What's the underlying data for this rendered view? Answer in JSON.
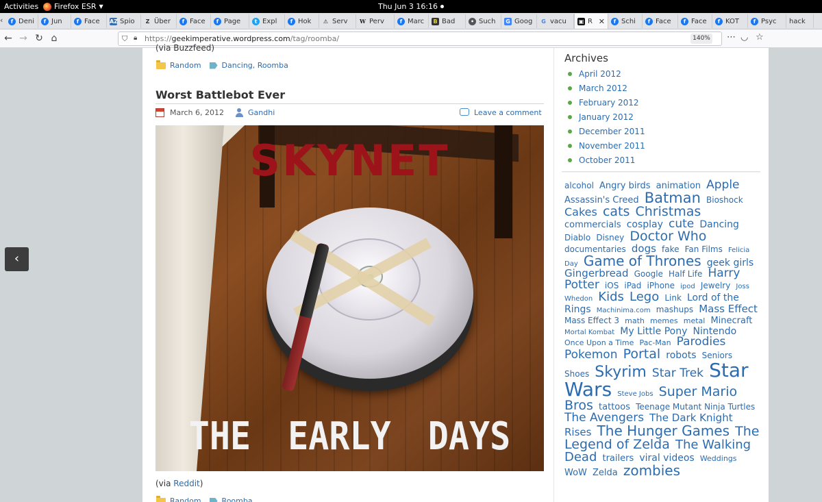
{
  "system": {
    "activities": "Activities",
    "app_name": "Firefox ESR",
    "clock": "Thu Jun 3  16:16"
  },
  "tabs": [
    {
      "label": "Deni",
      "icon": "generic-icon"
    },
    {
      "label": "Jun",
      "icon": "facebook-icon"
    },
    {
      "label": "Face",
      "icon": "facebook-icon"
    },
    {
      "label": "Spio",
      "icon": "az-icon"
    },
    {
      "label": "Über",
      "icon": "z-icon"
    },
    {
      "label": "Face",
      "icon": "facebook-icon"
    },
    {
      "label": "Page",
      "icon": "facebook-icon"
    },
    {
      "label": "Expl",
      "icon": "twitter-icon"
    },
    {
      "label": "Hok",
      "icon": "facebook-icon"
    },
    {
      "label": "Serv",
      "icon": "warning-icon"
    },
    {
      "label": "Perv",
      "icon": "wikipedia-icon"
    },
    {
      "label": "Marc",
      "icon": "facebook-icon"
    },
    {
      "label": "Bad",
      "icon": "bad-icon"
    },
    {
      "label": "Such",
      "icon": "circle-icon"
    },
    {
      "label": "Goog",
      "icon": "google-translate-icon"
    },
    {
      "label": "vacu",
      "icon": "google-icon"
    },
    {
      "label": "R",
      "icon": "wordpress-icon",
      "active": true
    },
    {
      "label": "Schi",
      "icon": "facebook-icon"
    },
    {
      "label": "Face",
      "icon": "facebook-icon"
    },
    {
      "label": "Face",
      "icon": "facebook-icon"
    },
    {
      "label": "KOT",
      "icon": "facebook-icon"
    },
    {
      "label": "Psyc",
      "icon": "facebook-icon"
    },
    {
      "label": "hack",
      "icon": "none"
    }
  ],
  "navbar": {
    "url_prefix": "https://",
    "url_domain": "geekimperative.wordpress.com",
    "url_path": "/tag/roomba/",
    "zoom": "140%"
  },
  "previous_post": {
    "via": "(via Buzzfeed)",
    "category": "Random",
    "tags": "Dancing, Roomba"
  },
  "post": {
    "title": "Worst Battlebot Ever",
    "date": "March 6, 2012",
    "author": "Gandhi",
    "comment_link": "Leave a comment",
    "image_text_top": "SKYNET",
    "image_text_bottom": "THE EARLY DAYS",
    "via_prefix": "(via ",
    "via_link": "Reddit",
    "via_suffix": ")",
    "category": "Random",
    "tags": "Roomba"
  },
  "sidebar": {
    "archives_title": "Archives",
    "archives": [
      "April 2012",
      "March 2012",
      "February 2012",
      "January 2012",
      "December 2011",
      "November 2011",
      "October 2011"
    ],
    "tags": [
      {
        "t": "alcohol",
        "s": 12
      },
      {
        "t": "Angry birds",
        "s": 13
      },
      {
        "t": "animation",
        "s": 13
      },
      {
        "t": "Apple",
        "s": 17
      },
      {
        "t": "Assassin's Creed",
        "s": 13
      },
      {
        "t": "Batman",
        "s": 21
      },
      {
        "t": "Bioshock",
        "s": 12
      },
      {
        "t": "Cakes",
        "s": 16
      },
      {
        "t": "cats",
        "s": 19
      },
      {
        "t": "Christmas",
        "s": 19
      },
      {
        "t": "commercials",
        "s": 13
      },
      {
        "t": "cosplay",
        "s": 14
      },
      {
        "t": "cute",
        "s": 17
      },
      {
        "t": "Dancing",
        "s": 14
      },
      {
        "t": "Diablo",
        "s": 12
      },
      {
        "t": "Disney",
        "s": 12
      },
      {
        "t": "Doctor Who",
        "s": 19
      },
      {
        "t": "documentaries",
        "s": 12
      },
      {
        "t": "dogs",
        "s": 15
      },
      {
        "t": "fake",
        "s": 12
      },
      {
        "t": "Fan Films",
        "s": 12
      },
      {
        "t": "Felicia Day",
        "s": 10
      },
      {
        "t": "Game of Thrones",
        "s": 20
      },
      {
        "t": "geek girls",
        "s": 14
      },
      {
        "t": "Gingerbread",
        "s": 15
      },
      {
        "t": "Google",
        "s": 12
      },
      {
        "t": "Half Life",
        "s": 12
      },
      {
        "t": "Harry Potter",
        "s": 17
      },
      {
        "t": "iOS",
        "s": 12
      },
      {
        "t": "iPad",
        "s": 12
      },
      {
        "t": "iPhone",
        "s": 12
      },
      {
        "t": "ipod",
        "s": 10
      },
      {
        "t": "Jewelry",
        "s": 12
      },
      {
        "t": "Joss Whedon",
        "s": 10
      },
      {
        "t": "Kids",
        "s": 18
      },
      {
        "t": "Lego",
        "s": 18
      },
      {
        "t": "Link",
        "s": 12
      },
      {
        "t": "Lord of the Rings",
        "s": 14
      },
      {
        "t": "Machinima.com",
        "s": 10
      },
      {
        "t": "mashups",
        "s": 12
      },
      {
        "t": "Mass Effect",
        "s": 15
      },
      {
        "t": "Mass Effect 3",
        "s": 12
      },
      {
        "t": "math",
        "s": 11
      },
      {
        "t": "memes",
        "s": 11
      },
      {
        "t": "metal",
        "s": 11
      },
      {
        "t": "Minecraft",
        "s": 13
      },
      {
        "t": "Mortal Kombat",
        "s": 10
      },
      {
        "t": "My Little Pony",
        "s": 14
      },
      {
        "t": "Nintendo",
        "s": 14
      },
      {
        "t": "Once Upon a Time",
        "s": 11
      },
      {
        "t": "Pac-Man",
        "s": 11
      },
      {
        "t": "Parodies",
        "s": 17
      },
      {
        "t": "Pokemon",
        "s": 17
      },
      {
        "t": "Portal",
        "s": 19
      },
      {
        "t": "robots",
        "s": 14
      },
      {
        "t": "Seniors",
        "s": 12
      },
      {
        "t": "Shoes",
        "s": 12
      },
      {
        "t": "Skyrim",
        "s": 22
      },
      {
        "t": "Star Trek",
        "s": 17
      },
      {
        "t": "Star Wars",
        "s": 28
      },
      {
        "t": "Steve Jobs",
        "s": 10
      },
      {
        "t": "Super Mario Bros",
        "s": 19
      },
      {
        "t": "tattoos",
        "s": 13
      },
      {
        "t": "Teenage Mutant Ninja Turtles",
        "s": 12
      },
      {
        "t": "The Avengers",
        "s": 17
      },
      {
        "t": "The Dark Knight Rises",
        "s": 15
      },
      {
        "t": "The Hunger Games",
        "s": 20
      },
      {
        "t": "The Legend of Zelda",
        "s": 19
      },
      {
        "t": "The Walking Dead",
        "s": 18
      },
      {
        "t": "trailers",
        "s": 13
      },
      {
        "t": "viral videos",
        "s": 14
      },
      {
        "t": "Weddings",
        "s": 11
      },
      {
        "t": "WoW",
        "s": 13
      },
      {
        "t": "Zelda",
        "s": 13
      },
      {
        "t": "zombies",
        "s": 20
      }
    ]
  }
}
